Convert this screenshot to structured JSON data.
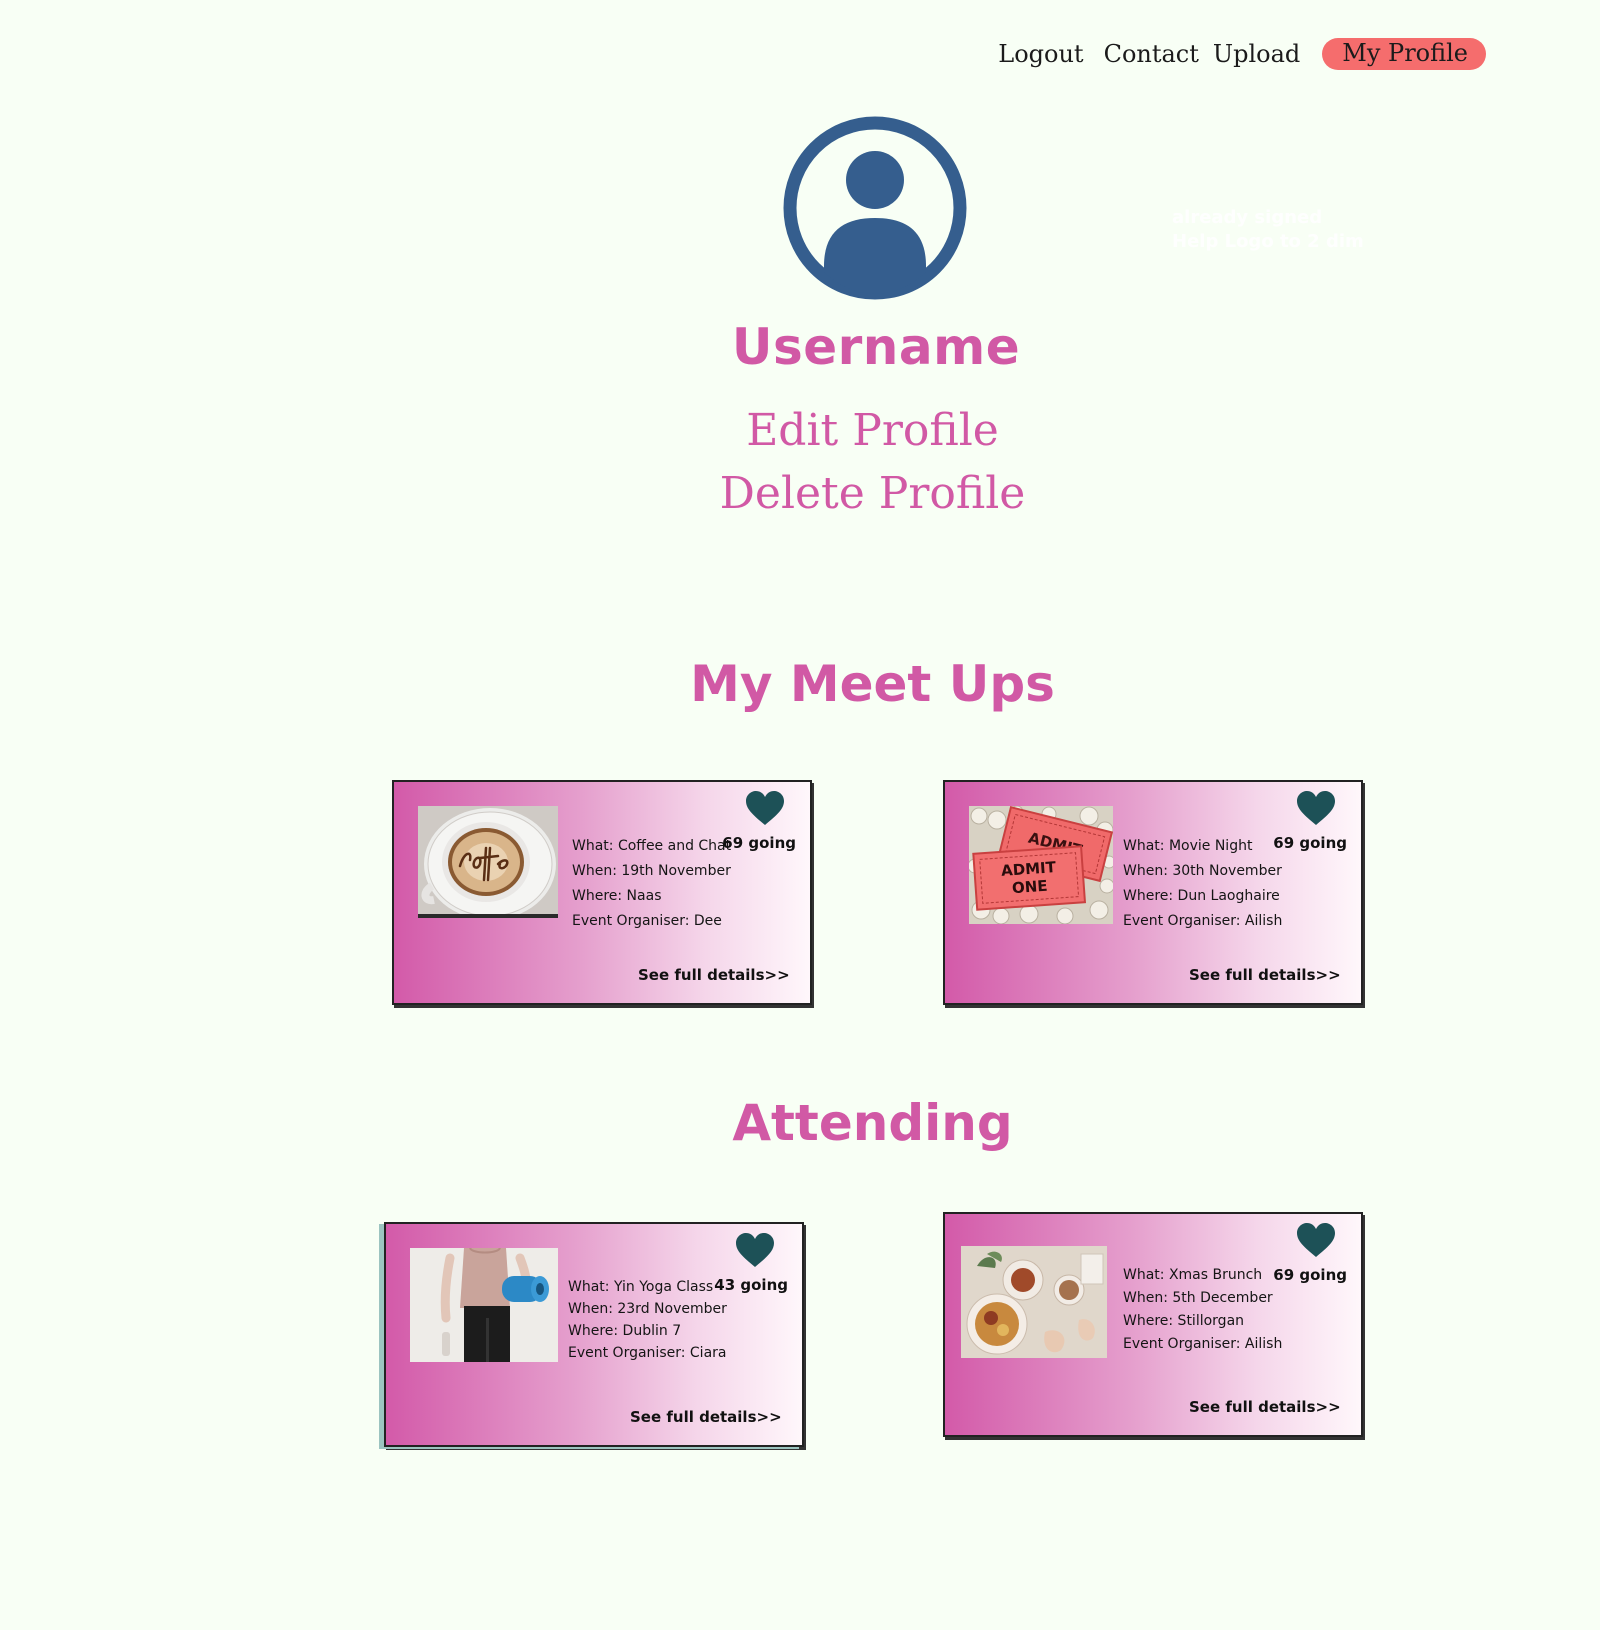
{
  "nav": {
    "logout": "Logout",
    "contact": "Contact",
    "upload": "Upload",
    "my_profile": "My Profile"
  },
  "profile": {
    "username": "Username",
    "edit": "Edit Profile",
    "delete": "Delete Profile",
    "ghost_line1": "already signed",
    "ghost_line2": "Help Logo to 2 dim"
  },
  "sections": {
    "meetups": "My Meet Ups",
    "attending": "Attending"
  },
  "colors": {
    "accent": "#d159a5",
    "pill": "#f56d6d",
    "heart": "#1d5157",
    "avatar": "#355e8e",
    "background": "#f8fff5"
  },
  "meetups": [
    {
      "what": "What: Coffee and Chat",
      "when": "When: 19th November",
      "where": "Where: Naas",
      "organiser": "Event Organiser: Dee",
      "going": "69 going",
      "details": "See full details>>",
      "image": "coffee-cup-image"
    },
    {
      "what": "What: Movie Night",
      "when": "When: 30th November",
      "where": "Where: Dun Laoghaire",
      "organiser": "Event Organiser: Ailish",
      "going": "69 going",
      "details": "See full details>>",
      "image": "admit-one-tickets-image",
      "ticket_text": "ADMIT ONE"
    }
  ],
  "attending": [
    {
      "what": "What: Yin Yoga Class",
      "when": "When: 23rd November",
      "where": "Where: Dublin 7",
      "organiser": "Event Organiser: Ciara",
      "going": "43 going",
      "details": "See full details>>",
      "image": "yoga-mat-image"
    },
    {
      "what": "What: Xmas Brunch",
      "when": "When: 5th December",
      "where": "Where: Stillorgan",
      "organiser": "Event Organiser: Ailish",
      "going": "69 going",
      "details": "See full details>>",
      "image": "brunch-table-image"
    }
  ]
}
